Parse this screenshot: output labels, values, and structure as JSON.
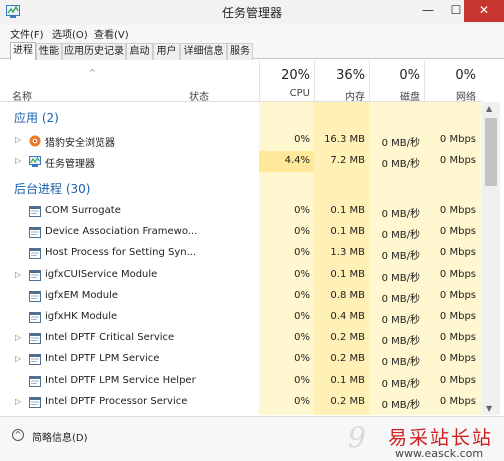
{
  "window": {
    "title": "任务管理器",
    "minimize": "—",
    "maximize": "☐",
    "close": "✕"
  },
  "menu": [
    "文件(F)",
    "选项(O)",
    "查看(V)"
  ],
  "tabs": [
    "进程",
    "性能",
    "应用历史记录",
    "启动",
    "用户",
    "详细信息",
    "服务"
  ],
  "header": {
    "name_label": "名称",
    "status_label": "状态",
    "sort_arrow": "^",
    "columns": [
      {
        "pct": "20%",
        "label": "CPU"
      },
      {
        "pct": "36%",
        "label": "内存"
      },
      {
        "pct": "0%",
        "label": "磁盘"
      },
      {
        "pct": "0%",
        "label": "网络"
      }
    ]
  },
  "groups": {
    "apps": "应用 (2)",
    "background": "后台进程 (30)"
  },
  "apps": [
    {
      "name": "猎豹安全浏览器",
      "icon": "cheetah-browser-icon",
      "cpu": "0%",
      "mem": "16.3 MB",
      "disk": "0 MB/秒",
      "net": "0 Mbps"
    },
    {
      "name": "任务管理器",
      "icon": "task-manager-icon",
      "cpu": "4.4%",
      "mem": "7.2 MB",
      "disk": "0 MB/秒",
      "net": "0 Mbps"
    }
  ],
  "background": [
    {
      "name": "COM Surrogate",
      "expandable": false,
      "cpu": "0%",
      "mem": "0.1 MB",
      "disk": "0 MB/秒",
      "net": "0 Mbps"
    },
    {
      "name": "Device Association Framewo...",
      "expandable": false,
      "cpu": "0%",
      "mem": "0.1 MB",
      "disk": "0 MB/秒",
      "net": "0 Mbps"
    },
    {
      "name": "Host Process for Setting Syn...",
      "expandable": false,
      "cpu": "0%",
      "mem": "1.3 MB",
      "disk": "0 MB/秒",
      "net": "0 Mbps"
    },
    {
      "name": "igfxCUIService Module",
      "expandable": true,
      "cpu": "0%",
      "mem": "0.1 MB",
      "disk": "0 MB/秒",
      "net": "0 Mbps"
    },
    {
      "name": "igfxEM Module",
      "expandable": false,
      "cpu": "0%",
      "mem": "0.8 MB",
      "disk": "0 MB/秒",
      "net": "0 Mbps"
    },
    {
      "name": "igfxHK Module",
      "expandable": false,
      "cpu": "0%",
      "mem": "0.4 MB",
      "disk": "0 MB/秒",
      "net": "0 Mbps"
    },
    {
      "name": "Intel DPTF Critical Service",
      "expandable": true,
      "cpu": "0%",
      "mem": "0.2 MB",
      "disk": "0 MB/秒",
      "net": "0 Mbps"
    },
    {
      "name": "Intel DPTF LPM Service",
      "expandable": true,
      "cpu": "0%",
      "mem": "0.2 MB",
      "disk": "0 MB/秒",
      "net": "0 Mbps"
    },
    {
      "name": "Intel DPTF LPM Service Helper",
      "expandable": false,
      "cpu": "0%",
      "mem": "0.1 MB",
      "disk": "0 MB/秒",
      "net": "0 Mbps"
    },
    {
      "name": "Intel DPTF Processor Service",
      "expandable": true,
      "cpu": "0%",
      "mem": "0.2 MB",
      "disk": "0 MB/秒",
      "net": "0 Mbps"
    }
  ],
  "footer": {
    "fewer_details": "简略信息(D)",
    "fewer_icon": "chevron-up-icon"
  },
  "watermark": {
    "logo": "9",
    "text": "易采站长站",
    "url": "www.easck.com"
  },
  "colors": {
    "cpu_band": "#fff7cf",
    "mem_band": "#fff1b6",
    "highlight": "#ffe89a",
    "group_text": "#1c5fa8",
    "close": "#c7372f"
  }
}
